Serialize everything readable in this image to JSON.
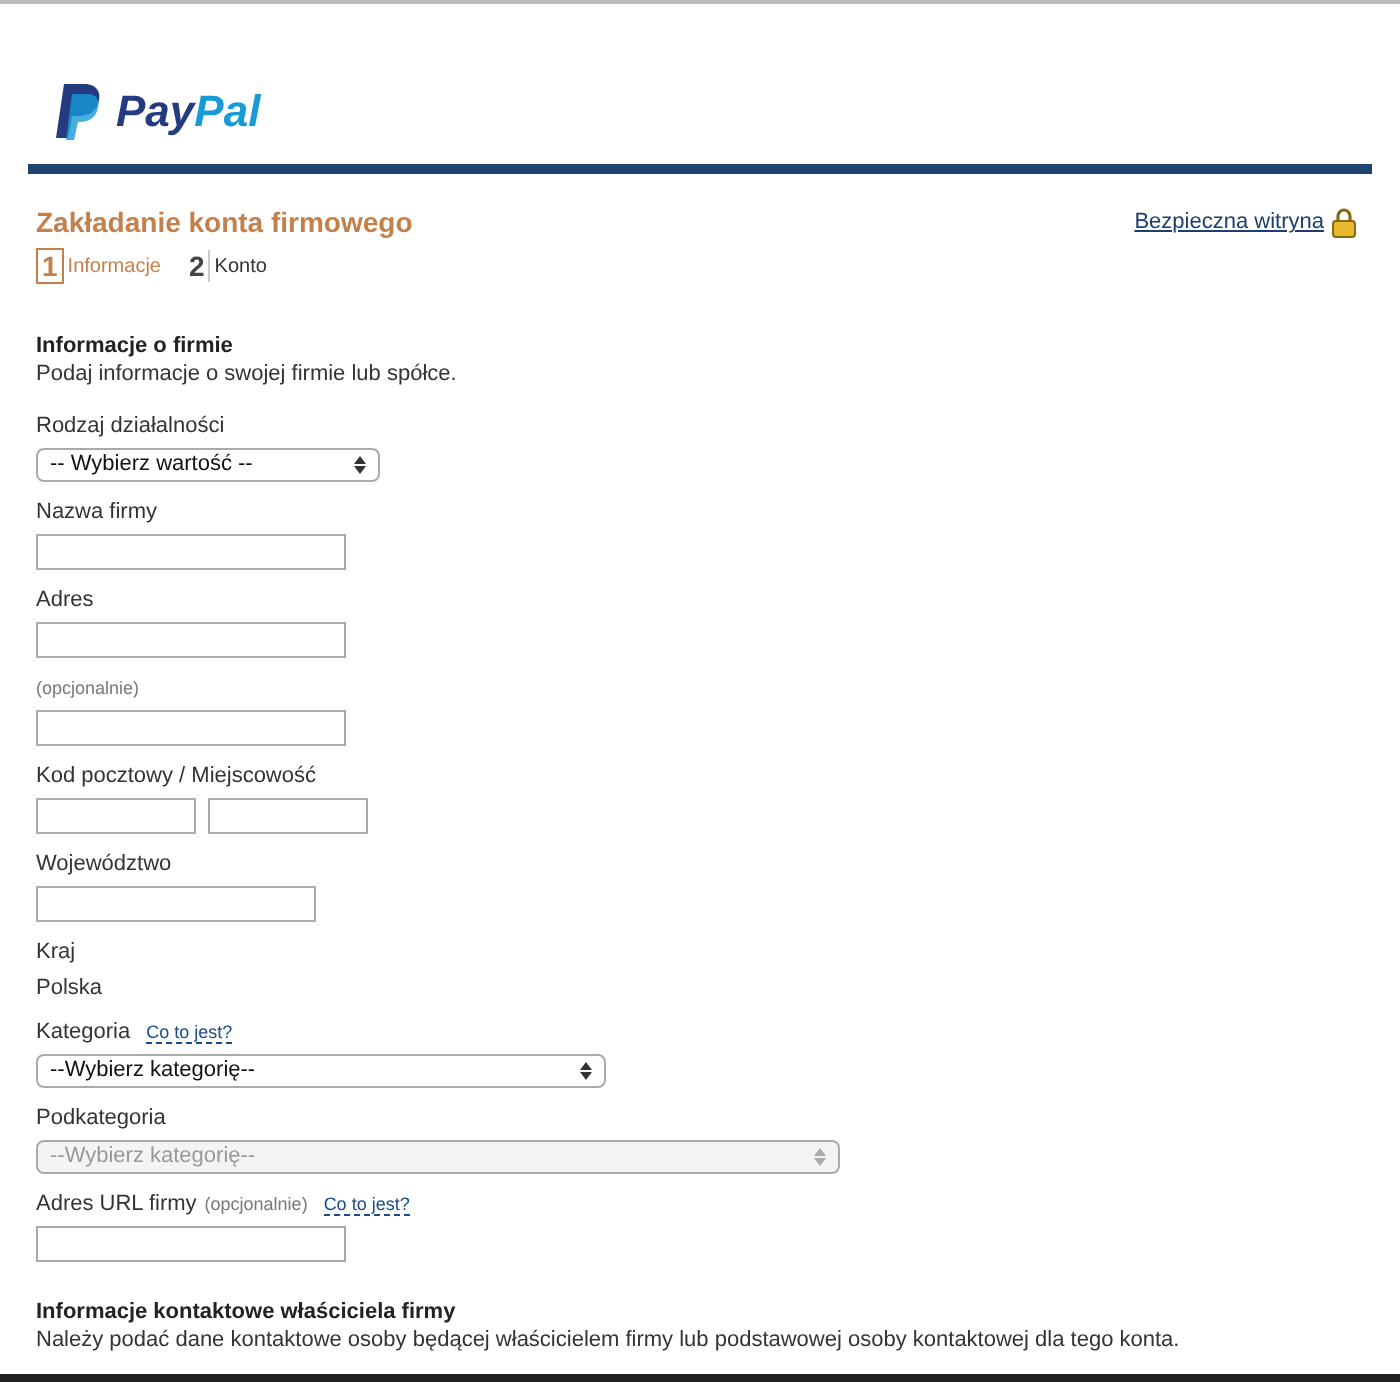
{
  "logo": {
    "text_dark": "Pay",
    "text_light": "Pal"
  },
  "header": {
    "title": "Zakładanie konta firmowego",
    "secure_link": "Bezpieczna witryna"
  },
  "steps": [
    {
      "number": "1",
      "label": "Informacje",
      "selected": true
    },
    {
      "number": "2",
      "label": "Konto",
      "selected": false
    }
  ],
  "section": {
    "heading": "Informacje o firmie",
    "description": "Podaj informacje o swojej firmie lub spółce."
  },
  "fields": [
    {
      "kind": "select",
      "label": "Rodzaj działalności",
      "value": "-- Wybierz wartość --",
      "disabled": false
    },
    {
      "kind": "text",
      "label": "Nazwa firmy"
    },
    {
      "kind": "text",
      "label": "Adres"
    },
    {
      "kind": "text",
      "note": "(opcjonalnie)"
    },
    {
      "kind": "pair",
      "label": "Kod pocztowy / Miejscowość"
    },
    {
      "kind": "text",
      "label": "Województwo"
    },
    {
      "kind": "static",
      "label": "Kraj",
      "value": "Polska"
    },
    {
      "kind": "select",
      "label": "Kategoria",
      "help": "Co to jest?",
      "value": "--Wybierz kategorię--",
      "disabled": false
    },
    {
      "kind": "select",
      "label": "Podkategoria",
      "value": "--Wybierz kategorię--",
      "disabled": true
    },
    {
      "kind": "text",
      "label": "Adres URL firmy",
      "note": "(opcjonalnie)",
      "help": "Co to jest?"
    }
  ],
  "contact_section": {
    "heading": "Informacje kontaktowe właściciela firmy",
    "description": "Należy podać dane kontaktowe osoby będącej właścicielem firmy lub podstawowej osoby kontaktowej dla tego konta."
  }
}
